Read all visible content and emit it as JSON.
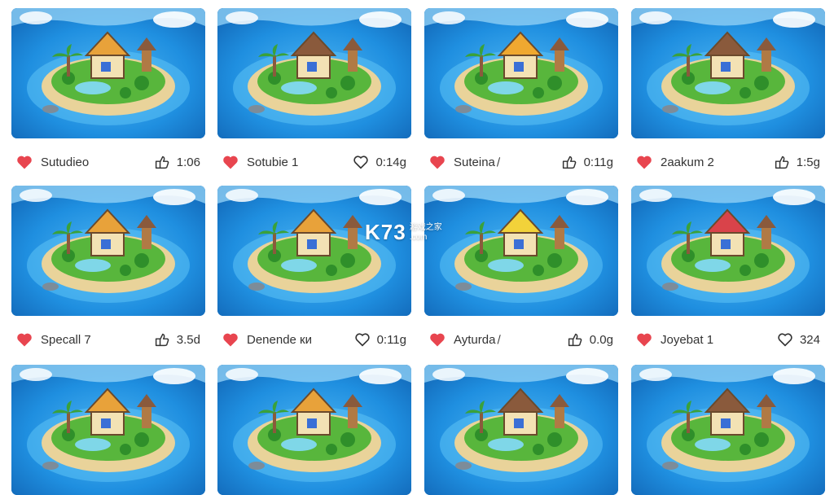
{
  "colors": {
    "ocean_deep": "#1677c9",
    "ocean_light": "#4fb6f2",
    "sand": "#e9d39a",
    "grass": "#58b63c",
    "heart_red": "#e8454f",
    "text": "#333333"
  },
  "watermark": {
    "logo": "K73",
    "cn": "游戏之家",
    "domain": ".com"
  },
  "cards": [
    {
      "title": "Sutudieo",
      "stat_icon": "share-icon",
      "stat": "1:06",
      "roof": "#e8a23a"
    },
    {
      "title": "Sotubie 1",
      "stat_icon": "heart-outline-icon",
      "stat": "0:14g",
      "roof": "#8a5a3c"
    },
    {
      "title": "Suteina ̸",
      "stat_icon": "share-icon",
      "stat": "0:11g",
      "roof": "#f0a830"
    },
    {
      "title": "2aakum 2",
      "stat_icon": "share-icon",
      "stat": "1:5g",
      "roof": "#8a5a3c"
    },
    {
      "title": "Specall 7",
      "stat_icon": "share-icon",
      "stat": "3.5d",
      "roof": "#e8a23a"
    },
    {
      "title": "Denende ки",
      "stat_icon": "heart-outline-icon",
      "stat": "0:11g",
      "roof": "#e8a23a"
    },
    {
      "title": "Ayturda ̸",
      "stat_icon": "share-icon",
      "stat": "0.0g",
      "roof": "#f2d23a"
    },
    {
      "title": "Joyebat 1",
      "stat_icon": "heart-outline-icon",
      "stat": "324",
      "roof": "#d9434a"
    },
    {
      "title": "",
      "stat_icon": "",
      "stat": "",
      "roof": "#e8a23a"
    },
    {
      "title": "",
      "stat_icon": "",
      "stat": "",
      "roof": "#e8a23a"
    },
    {
      "title": "",
      "stat_icon": "",
      "stat": "",
      "roof": "#8a5a3c"
    },
    {
      "title": "",
      "stat_icon": "",
      "stat": "",
      "roof": "#8a5a3c"
    }
  ]
}
